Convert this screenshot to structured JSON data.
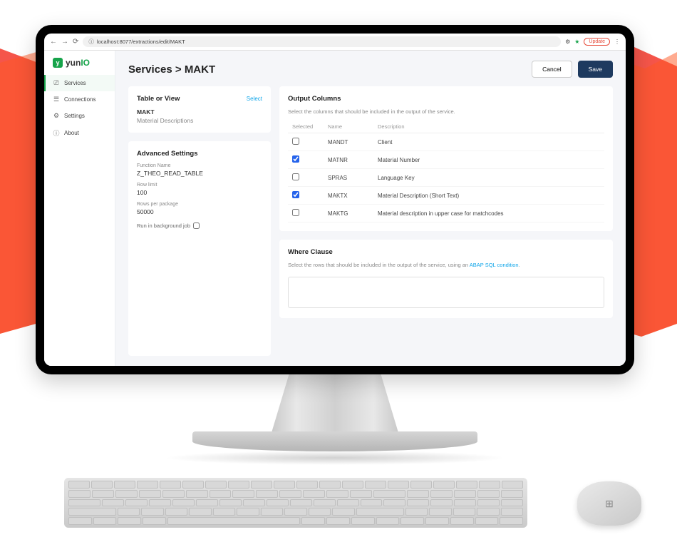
{
  "browser": {
    "url": "localhost:8077/extractions/edit/MAKT",
    "update_label": "Update"
  },
  "logo": {
    "brand_left": "yun",
    "brand_right": "IO"
  },
  "sidebar": {
    "items": [
      {
        "label": "Services",
        "icon": "services"
      },
      {
        "label": "Connections",
        "icon": "connections"
      },
      {
        "label": "Settings",
        "icon": "settings"
      },
      {
        "label": "About",
        "icon": "about"
      }
    ]
  },
  "header": {
    "breadcrumb": "Services > MAKT",
    "cancel_label": "Cancel",
    "save_label": "Save"
  },
  "table_view": {
    "title": "Table or View",
    "select_link": "Select",
    "name_label": "MAKT",
    "name_desc": "Material Descriptions"
  },
  "advanced": {
    "title": "Advanced Settings",
    "function_label": "Function Name",
    "function_value": "Z_THEO_READ_TABLE",
    "rowlimit_label": "Row limit",
    "rowlimit_value": "100",
    "rpp_label": "Rows per package",
    "rpp_value": "50000",
    "runbg_label": "Run in background job"
  },
  "output": {
    "title": "Output Columns",
    "subtitle": "Select the columns that should be included in the output of the service.",
    "th_selected": "Selected",
    "th_name": "Name",
    "th_desc": "Description",
    "rows": [
      {
        "selected": false,
        "name": "MANDT",
        "desc": "Client"
      },
      {
        "selected": true,
        "name": "MATNR",
        "desc": "Material Number"
      },
      {
        "selected": false,
        "name": "SPRAS",
        "desc": "Language Key"
      },
      {
        "selected": true,
        "name": "MAKTX",
        "desc": "Material Description (Short Text)"
      },
      {
        "selected": false,
        "name": "MAKTG",
        "desc": "Material description in upper case for matchcodes"
      }
    ]
  },
  "where": {
    "title": "Where Clause",
    "subtitle_before": "Select the rows that should be included in the output of the service, using an ",
    "subtitle_link": "ABAP SQL condition",
    "subtitle_after": "."
  }
}
